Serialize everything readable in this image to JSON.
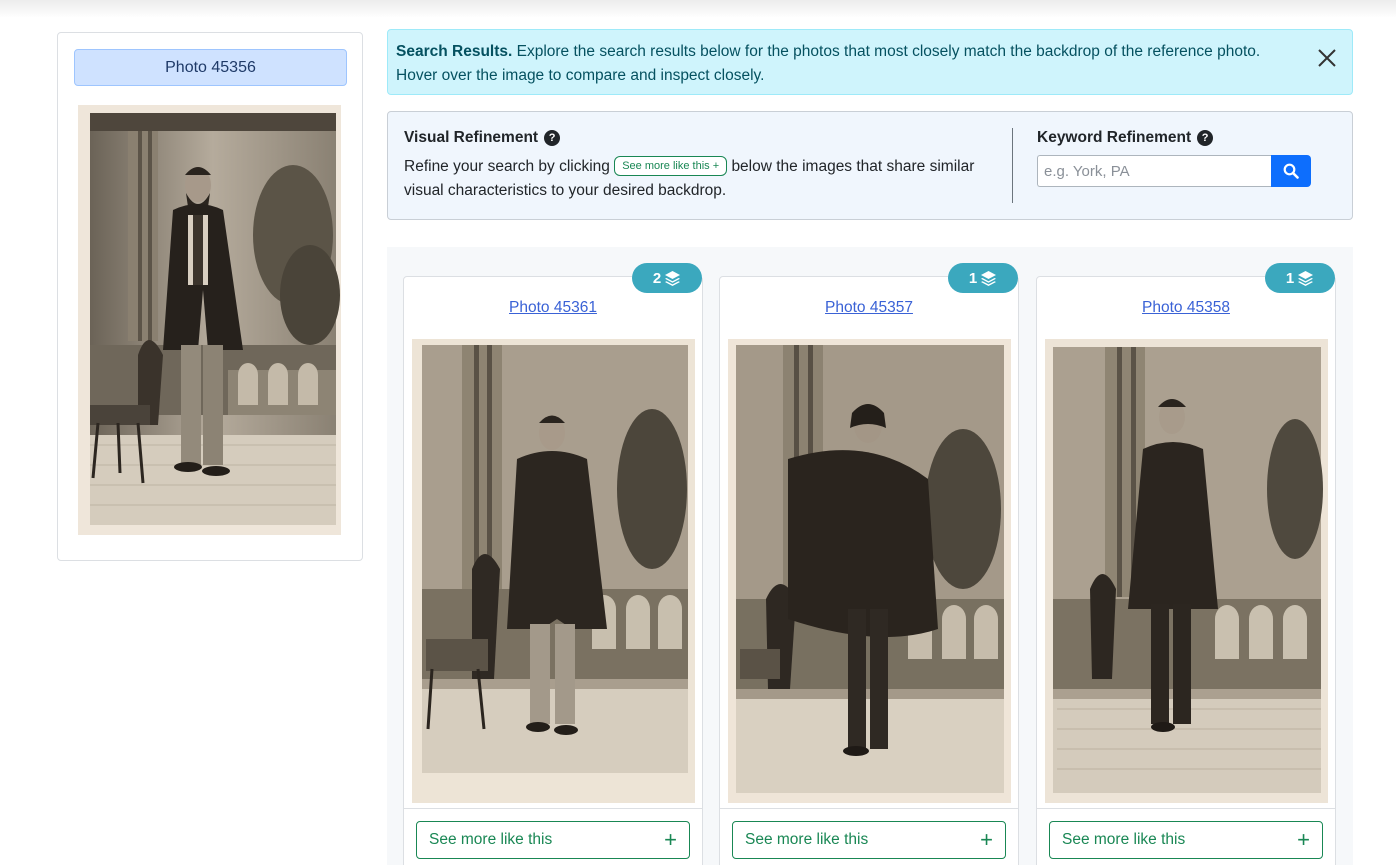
{
  "reference": {
    "title": "Photo 45356"
  },
  "alert": {
    "heading": "Search Results.",
    "line1": "Explore the search results below for the photos that most closely match the backdrop of the reference photo.",
    "line2": "Hover over the image to compare and inspect closely."
  },
  "visual_refinement": {
    "title": "Visual Refinement",
    "text_before": "Refine your search by clicking",
    "chip_label": "See more like this +",
    "text_after": "below the images that share similar visual characteristics to your desired backdrop."
  },
  "keyword_refinement": {
    "title": "Keyword Refinement",
    "placeholder": "e.g. York, PA",
    "value": ""
  },
  "results": [
    {
      "title": "Photo 45361",
      "count": "2",
      "more_label": "See more like this"
    },
    {
      "title": "Photo 45357",
      "count": "1",
      "more_label": "See more like this"
    },
    {
      "title": "Photo 45358",
      "count": "1",
      "more_label": "See more like this"
    }
  ],
  "colors": {
    "alert_bg": "#cff4fc",
    "refine_bg": "#f0f6fd",
    "badge": "#3ba8be",
    "primary": "#0d6efd",
    "success": "#198754"
  }
}
